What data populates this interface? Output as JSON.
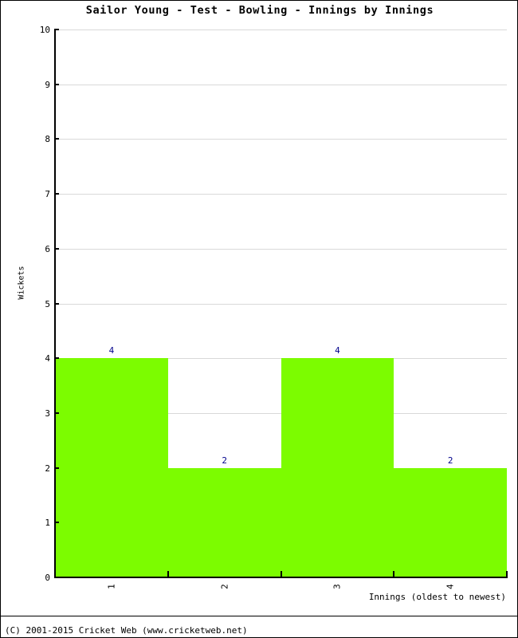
{
  "chart_data": {
    "type": "bar",
    "title": "Sailor Young - Test - Bowling - Innings by Innings",
    "xlabel": "Innings (oldest to newest)",
    "ylabel": "Wickets",
    "categories": [
      "1",
      "2",
      "3",
      "4"
    ],
    "values": [
      4,
      2,
      4,
      2
    ],
    "value_labels": [
      "4",
      "2",
      "4",
      "2"
    ],
    "ylim": [
      0,
      10
    ],
    "ytick_labels": [
      "0",
      "1",
      "2",
      "3",
      "4",
      "5",
      "6",
      "7",
      "8",
      "9",
      "10"
    ],
    "ytick_values": [
      0,
      1,
      2,
      3,
      4,
      5,
      6,
      7,
      8,
      9,
      10
    ],
    "grid": true,
    "legend": "none",
    "bar_color": "#7cfc00",
    "value_label_color": "#00008b",
    "gridline_color": "#d9d9d9",
    "axis_color": "#000000",
    "background_color": "#ffffff"
  },
  "footer": {
    "copyright": "(C) 2001-2015 Cricket Web (www.cricketweb.net)"
  }
}
